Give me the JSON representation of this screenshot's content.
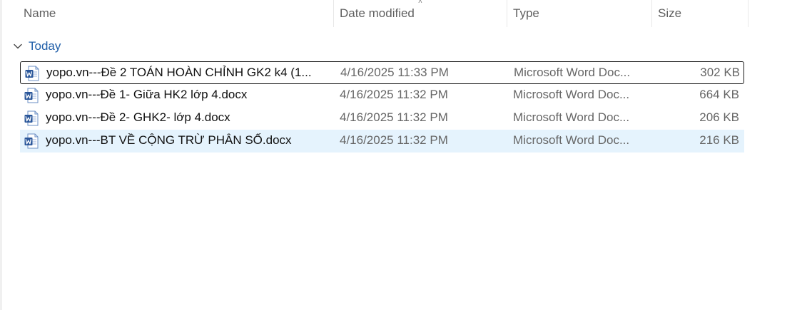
{
  "columns": {
    "name": "Name",
    "date": "Date modified",
    "type": "Type",
    "size": "Size"
  },
  "sort_indicator": "chevron-up",
  "group": {
    "label": "Today",
    "expanded": true
  },
  "files": [
    {
      "name": "yopo.vn---Đề 2  TOÁN HOÀN CHỈNH GK2 k4 (1...",
      "date": "4/16/2025 11:33 PM",
      "type": "Microsoft Word Doc...",
      "size": "302 KB",
      "state": "focused",
      "icon": "word-document-icon"
    },
    {
      "name": "yopo.vn---Đề 1- Giữa HK2 lớp 4.docx",
      "date": "4/16/2025 11:32 PM",
      "type": "Microsoft Word Doc...",
      "size": "664 KB",
      "state": "normal",
      "icon": "word-document-icon"
    },
    {
      "name": "yopo.vn---Đề  2- GHK2- lớp 4.docx",
      "date": "4/16/2025 11:32 PM",
      "type": "Microsoft Word Doc...",
      "size": "206 KB",
      "state": "normal",
      "icon": "word-document-icon"
    },
    {
      "name": "yopo.vn---BT VỀ CỘNG TRỪ PHÂN SỐ.docx",
      "date": "4/16/2025 11:32 PM",
      "type": "Microsoft Word Doc...",
      "size": "216 KB",
      "state": "hovered",
      "icon": "word-document-icon"
    }
  ],
  "colors": {
    "group_label": "#1f5ea8",
    "hover_bg": "#e5f3fd",
    "word_blue": "#2b579a",
    "header_text": "#5f5f5f"
  }
}
